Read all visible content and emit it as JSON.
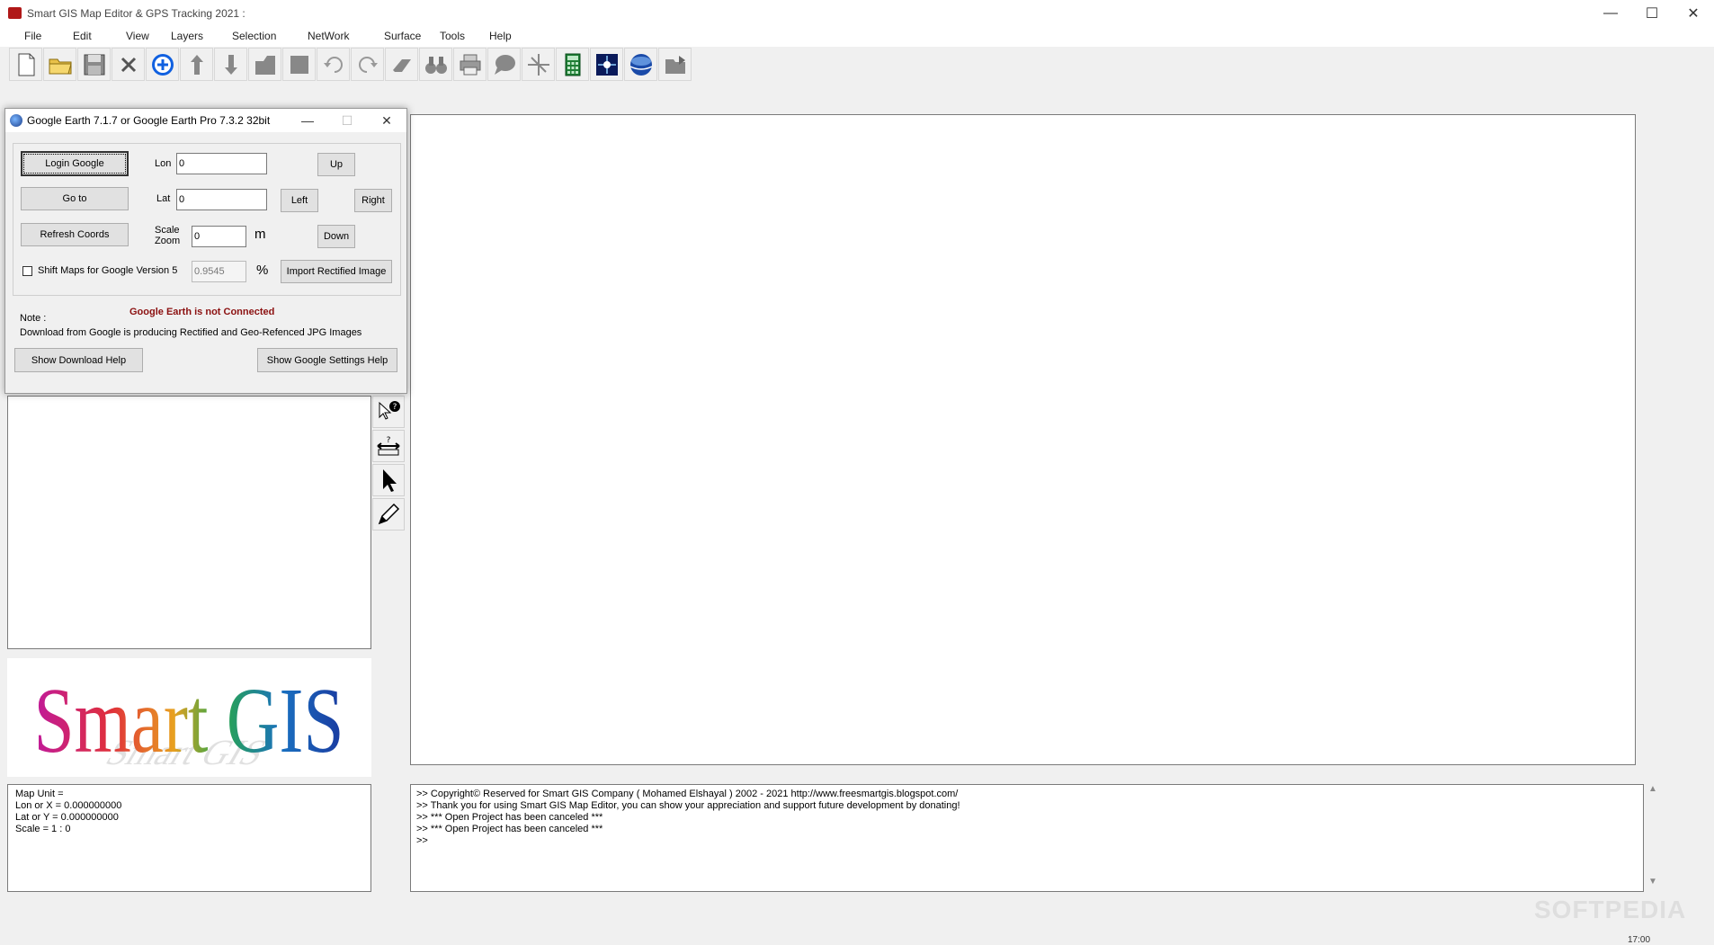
{
  "window": {
    "title": "Smart GIS Map Editor & GPS Tracking 2021 :",
    "minimize": "—",
    "maximize": "☐",
    "close": "✕"
  },
  "menu": [
    "File",
    "Edit",
    "View",
    "Layers",
    "Selection",
    "NetWork",
    "Surface",
    "Tools",
    "Help"
  ],
  "toolbar": [
    {
      "icon": "new-file-icon"
    },
    {
      "icon": "open-folder-icon"
    },
    {
      "icon": "save-icon"
    },
    {
      "icon": "delete-icon"
    },
    {
      "icon": "add-icon"
    },
    {
      "icon": "move-up-icon"
    },
    {
      "icon": "move-down-icon"
    },
    {
      "icon": "layer-shape-icon"
    },
    {
      "icon": "rectangle-icon"
    },
    {
      "icon": "undo-icon"
    },
    {
      "icon": "redo-icon"
    },
    {
      "icon": "eraser-icon"
    },
    {
      "icon": "binoculars-icon"
    },
    {
      "icon": "print-icon"
    },
    {
      "icon": "chat-bubble-icon"
    },
    {
      "icon": "crosshair-icon"
    },
    {
      "icon": "calculator-icon"
    },
    {
      "icon": "gps-icon"
    },
    {
      "icon": "globe-icon"
    },
    {
      "icon": "export-icon"
    }
  ],
  "dialog": {
    "title": "Google Earth 7.1.7   or   Google Earth Pro 7.3.2  32bit",
    "login_btn": "Login Google",
    "goto_btn": "Go to",
    "refresh_btn": "Refresh Coords",
    "lon_label": "Lon",
    "lon_value": "0",
    "lat_label": "Lat",
    "lat_value": "0",
    "scale_label": "Scale",
    "zoom_label": "Zoom",
    "scale_value": "0",
    "scale_unit": "m",
    "percent_value": "0.9545",
    "percent_unit": "%",
    "up_btn": "Up",
    "left_btn": "Left",
    "right_btn": "Right",
    "down_btn": "Down",
    "shift_label": "Shift Maps for Google Version 5",
    "import_btn": "Import Rectified Image",
    "status": "Google Earth is not Connected",
    "note_label": "Note :",
    "note_text": "Download from Google is producing Rectified and Geo-Refenced JPG Images",
    "download_help_btn": "Show Download Help",
    "settings_help_btn": "Show Google Settings Help"
  },
  "logo": {
    "text": "Smart GIS"
  },
  "info": {
    "map_unit": "Map Unit =",
    "lon": "Lon or X   = 0.000000000",
    "lat": "Lat or Y   = 0.000000000",
    "scale": "Scale       = 1 : 0"
  },
  "log": [
    ">>  Copyright© Reserved for Smart GIS Company ( Mohamed Elshayal ) 2002 - 2021  http://www.freesmartgis.blogspot.com/",
    ">>  Thank you for using Smart GIS Map Editor, you can show your appreciation and support future development by donating!",
    ">>   *** Open Project has been canceled ***",
    ">>   *** Open Project has been canceled ***",
    ">>"
  ],
  "watermark": "SOFTPEDIA",
  "clock": "17:00",
  "colors": {
    "status_red": "#8b1010",
    "app_icon": "#b01818"
  }
}
